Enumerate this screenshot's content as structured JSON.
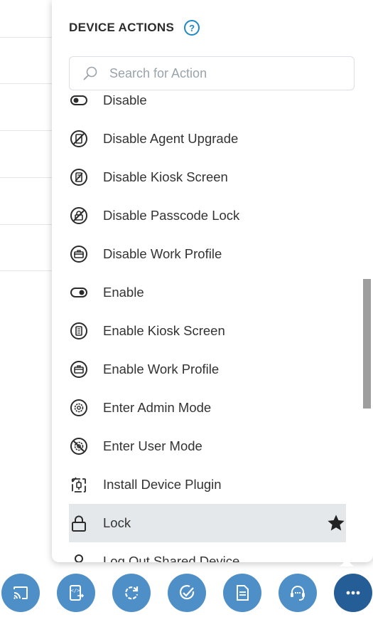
{
  "panel": {
    "title": "DEVICE ACTIONS",
    "help": "?",
    "search_placeholder": "Search for Action"
  },
  "actions": [
    {
      "label": "Disable",
      "icon": "toggle-off-icon"
    },
    {
      "label": "Disable Agent Upgrade",
      "icon": "agent-upgrade-disabled-icon"
    },
    {
      "label": "Disable Kiosk Screen",
      "icon": "kiosk-disabled-icon"
    },
    {
      "label": "Disable Passcode Lock",
      "icon": "passcode-disabled-icon"
    },
    {
      "label": "Disable Work Profile",
      "icon": "work-profile-disabled-icon"
    },
    {
      "label": "Enable",
      "icon": "toggle-on-icon"
    },
    {
      "label": "Enable Kiosk Screen",
      "icon": "kiosk-icon"
    },
    {
      "label": "Enable Work Profile",
      "icon": "briefcase-icon"
    },
    {
      "label": "Enter Admin Mode",
      "icon": "gear-icon"
    },
    {
      "label": "Enter User Mode",
      "icon": "gear-disabled-icon"
    },
    {
      "label": "Install Device Plugin",
      "icon": "plugin-install-icon"
    },
    {
      "label": "Lock",
      "icon": "lock-icon",
      "selected": true,
      "favorite": true
    },
    {
      "label": "Log Out Shared Device",
      "icon": "user-icon"
    }
  ],
  "toolbar": [
    {
      "name": "cast-button",
      "icon": "cast-icon"
    },
    {
      "name": "remote-script-button",
      "icon": "script-transfer-icon"
    },
    {
      "name": "sync-button",
      "icon": "refresh-icon"
    },
    {
      "name": "compliance-button",
      "icon": "check-circle-icon"
    },
    {
      "name": "document-button",
      "icon": "document-icon"
    },
    {
      "name": "support-button",
      "icon": "headset-icon"
    },
    {
      "name": "more-actions-button",
      "icon": "more-icon",
      "active": true
    }
  ],
  "colors": {
    "accent": "#1e88c7",
    "toolbar": "#4e8fc7",
    "toolbar_active": "#255d96",
    "selected_row": "#e5e8eb"
  }
}
